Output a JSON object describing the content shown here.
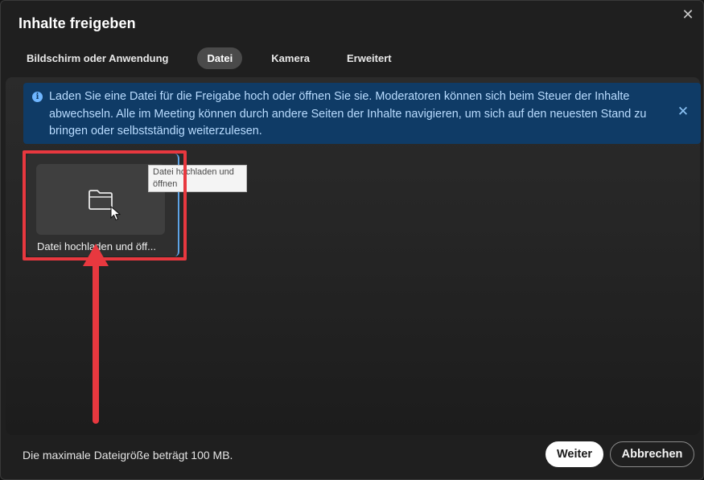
{
  "dialog": {
    "title": "Inhalte freigeben",
    "close_icon": "close-icon"
  },
  "tabs": [
    {
      "label": "Bildschirm oder Anwendung",
      "active": false
    },
    {
      "label": "Datei",
      "active": true
    },
    {
      "label": "Kamera",
      "active": false
    },
    {
      "label": "Erweitert",
      "active": false
    }
  ],
  "banner": {
    "icon": "info-icon",
    "text": "Laden Sie eine Datei für die Freigabe hoch oder öffnen Sie sie. Moderatoren können sich beim Steuer der Inhalte abwechseln. Alle im Meeting können durch andere Seiten der Inhalte navigieren, um sich auf den neuesten Stand zu bringen oder selbstständig weiterzulesen.",
    "close_icon": "close-icon"
  },
  "tile": {
    "icon": "folder-icon",
    "label": "Datei hochladen und öff..."
  },
  "tooltip": {
    "text": "Datei hochladen und öffnen"
  },
  "annotation": {
    "color": "#e8383f"
  },
  "footer": {
    "note": "Die maximale Dateigröße beträgt 100 MB.",
    "next_label": "Weiter",
    "cancel_label": "Abbrechen"
  },
  "colors": {
    "banner_bg": "#0f3b66",
    "banner_text": "#b9dcff",
    "tile_accent": "#5ea3e6"
  }
}
